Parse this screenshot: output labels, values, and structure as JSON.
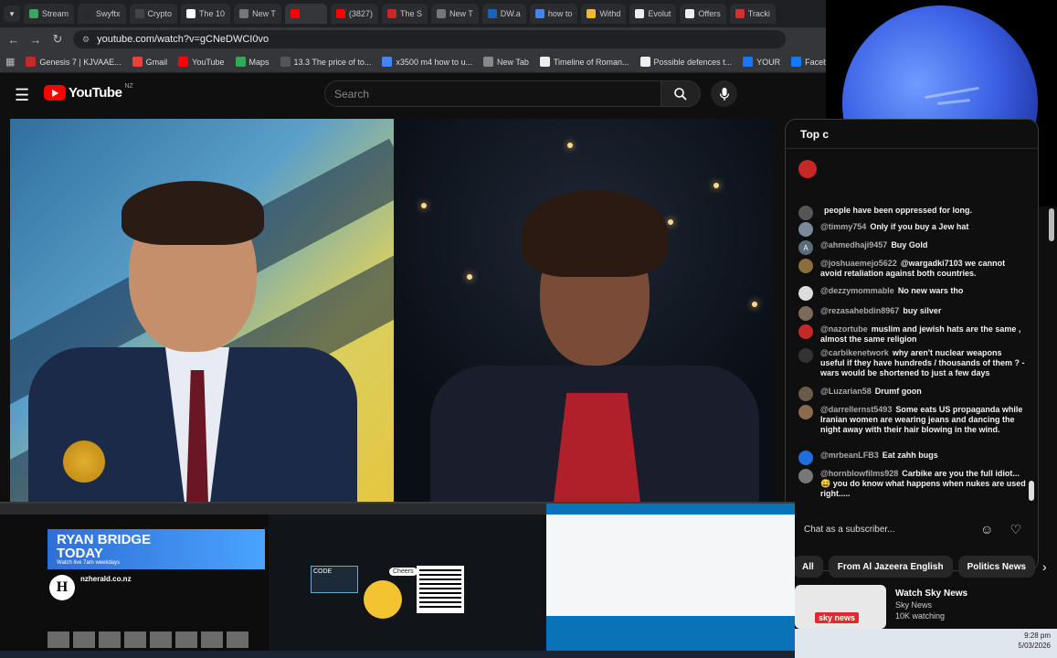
{
  "browser": {
    "tabs": [
      {
        "label": "Stream",
        "color": "#3ba55d"
      },
      {
        "label": "Swyftx",
        "color": "#2a2a2a"
      },
      {
        "label": "Crypto",
        "color": "#444"
      },
      {
        "label": "The 10",
        "color": "#fff"
      },
      {
        "label": "New T",
        "color": "#777"
      },
      {
        "label": "",
        "color": "#ff0000"
      },
      {
        "label": "(3827)",
        "color": "#ff0000"
      },
      {
        "label": "The S",
        "color": "#c62828"
      },
      {
        "label": "New T",
        "color": "#777"
      },
      {
        "label": "DW.a",
        "color": "#1565c0"
      },
      {
        "label": "how to",
        "color": "#4285f4"
      },
      {
        "label": "Withd",
        "color": "#f3ba2f"
      },
      {
        "label": "Evolut",
        "color": "#eee"
      },
      {
        "label": "Offers",
        "color": "#eee"
      },
      {
        "label": "Tracki",
        "color": "#d32f2f"
      }
    ],
    "url": "youtube.com/watch?v=gCNeDWCI0vo",
    "bookmarks": [
      {
        "label": "Genesis 7 | KJVAAE...",
        "color": "#c62828"
      },
      {
        "label": "Gmail",
        "color": "#ea4335"
      },
      {
        "label": "YouTube",
        "color": "#ff0000"
      },
      {
        "label": "Maps",
        "color": "#34a853"
      },
      {
        "label": "13.3 The price of to...",
        "color": "#555"
      },
      {
        "label": "x3500 m4 how to u...",
        "color": "#4285f4"
      },
      {
        "label": "New Tab",
        "color": "#888"
      },
      {
        "label": "Timeline of Roman...",
        "color": "#eee"
      },
      {
        "label": "Possible defences t...",
        "color": "#eee"
      },
      {
        "label": "YOUR",
        "color": "#1877f2"
      },
      {
        "label": "Facebook green",
        "color": "#1877f2"
      }
    ]
  },
  "youtube": {
    "logo_text": "YouTube",
    "region": "NZ",
    "search_placeholder": "Search"
  },
  "chat": {
    "header": "Top c",
    "messages": [
      {
        "author": "",
        "text": "people have been oppressed for long.",
        "avatar": "#555",
        "initial": ""
      },
      {
        "author": "@timmy754",
        "text": "Only if you buy a Jew hat",
        "avatar": "#7a8a9a",
        "initial": ""
      },
      {
        "author": "@ahmedhaji9457",
        "text": "Buy Gold",
        "avatar": "#5b6b7b",
        "initial": "A"
      },
      {
        "author": "@joshuaemejo5622",
        "text": "@wargadki7103 we cannot avoid retaliation against both countries.",
        "avatar": "#8a6d3b",
        "initial": ""
      },
      {
        "author": "@dezzymommable",
        "text": "No new wars tho",
        "avatar": "#ddd",
        "initial": ""
      },
      {
        "author": "@rezasahebdin8967",
        "text": "buy silver",
        "avatar": "#7a6a5a",
        "initial": ""
      },
      {
        "author": "@nazortube",
        "text": "muslim and jewish hats are the same , almost the same religion",
        "avatar": "#c62828",
        "initial": ""
      },
      {
        "author": "@carbikenetwork",
        "text": "why aren't nuclear weapons useful if they have hundreds / thousands of them ? - wars would be shortened to just a few days",
        "avatar": "#333",
        "initial": ""
      },
      {
        "author": "@Luzarian58",
        "text": "Drumf goon",
        "avatar": "#6a5a4a",
        "initial": ""
      },
      {
        "author": "@darrellernst5493",
        "text": "Some eats US propaganda while Iranian women are wearing jeans and dancing the night away with their hair blowing in the wind.",
        "avatar": "#8a6a4a",
        "initial": ""
      },
      {
        "author": "@mrbeanLFB3",
        "text": "Eat zahh bugs",
        "avatar": "#1e6fd9",
        "initial": ""
      },
      {
        "author": "@hornblowfilms928",
        "text": "Carbike are you the full idiot... 😅 you do know what happens when nukes are used right.....",
        "avatar": "#777",
        "initial": ""
      }
    ],
    "input_placeholder": "Chat as a subscriber..."
  },
  "chips": [
    "All",
    "From Al Jazeera English",
    "Politics News"
  ],
  "recommended": {
    "title": "Watch Sky News",
    "channel": "Sky News",
    "views": "10K watching",
    "logo": "sky news"
  },
  "thumbnails": {
    "banner_title": "RYAN BRIDGE TODAY",
    "banner_sub": "Watch live 7am weekdays",
    "herald_name": "nzherald.co.nz",
    "herald_initial": "H",
    "cheers": "Cheers",
    "code_label": "CODE"
  },
  "clock": {
    "time": "9:28 pm",
    "date": "5/03/2026"
  }
}
